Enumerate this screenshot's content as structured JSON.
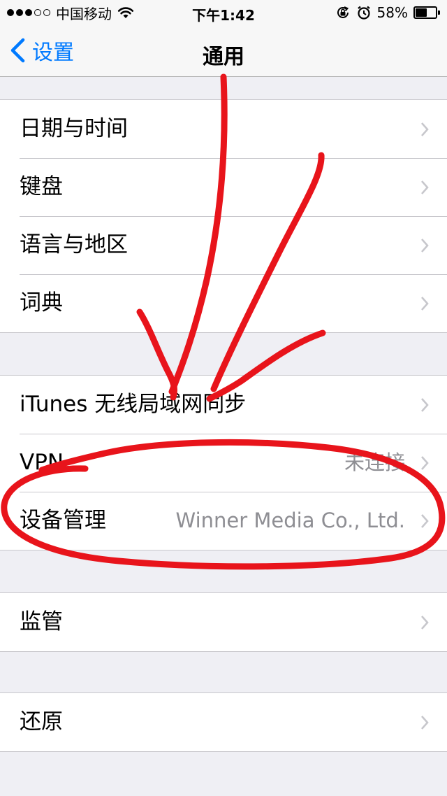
{
  "status_bar": {
    "carrier": "中国移动",
    "time": "下午1:42",
    "battery_percent": "58%",
    "battery_level": 0.58,
    "signal_bars_filled": 3,
    "signal_bars_total": 5,
    "icons": [
      "wifi-icon",
      "rotation-lock-icon",
      "alarm-icon",
      "battery-icon"
    ]
  },
  "nav": {
    "back_label": "设置",
    "title": "通用",
    "accent_color": "#007aff"
  },
  "groups": [
    {
      "items": [
        {
          "label": "日期与时间"
        },
        {
          "label": "键盘"
        },
        {
          "label": "语言与地区"
        },
        {
          "label": "词典"
        }
      ]
    },
    {
      "items": [
        {
          "label": "iTunes 无线局域网同步"
        },
        {
          "label": "VPN",
          "value": "未连接"
        },
        {
          "label": "设备管理",
          "value": "Winner Media Co., Ltd."
        }
      ]
    },
    {
      "items": [
        {
          "label": "监管"
        }
      ]
    },
    {
      "items": [
        {
          "label": "还原"
        }
      ]
    }
  ],
  "annotation": {
    "color": "#e8141b",
    "kind": "hand-drawn arrows pointing down and circle around device management row"
  }
}
